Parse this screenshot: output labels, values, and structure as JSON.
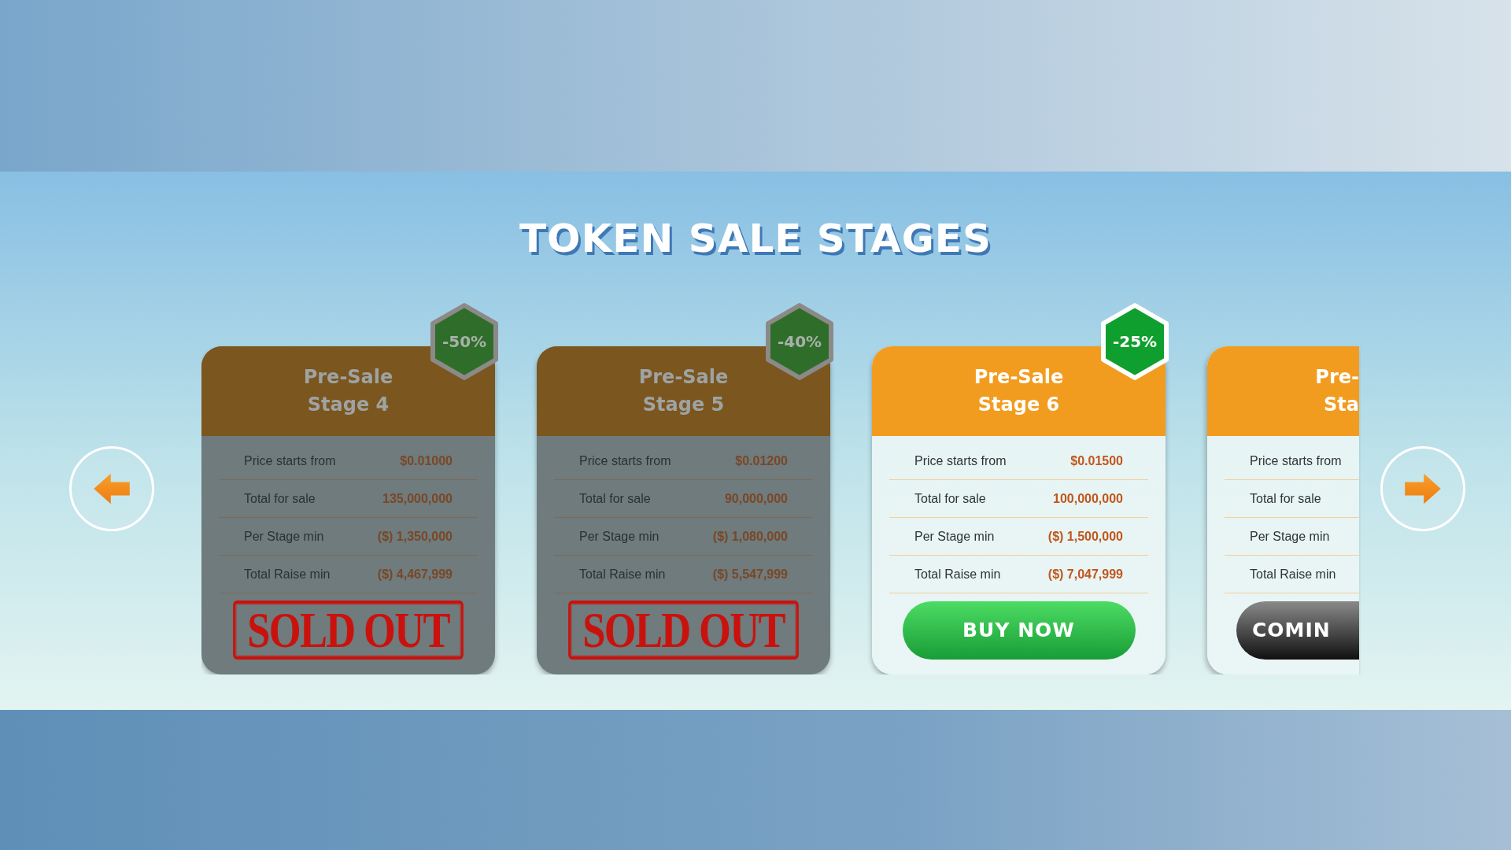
{
  "title": "TOKEN SALE STAGES",
  "stages": [
    {
      "name": "Pre-Sale",
      "stage": "Stage 4",
      "kind": "sold_out",
      "clipped": false,
      "discount": "-50%",
      "rows": [
        {
          "label": "Price starts from",
          "value": "$0.01000"
        },
        {
          "label": "Total for sale",
          "value": "135,000,000"
        },
        {
          "label": "Per Stage min",
          "value": "($) 1,350,000"
        },
        {
          "label": "Total Raise min",
          "value": "($) 4,467,999"
        }
      ],
      "stamp": "SOLD OUT"
    },
    {
      "name": "Pre-Sale",
      "stage": "Stage 5",
      "kind": "sold_out",
      "clipped": false,
      "discount": "-40%",
      "rows": [
        {
          "label": "Price starts from",
          "value": "$0.01200"
        },
        {
          "label": "Total for sale",
          "value": "90,000,000"
        },
        {
          "label": "Per Stage min",
          "value": "($) 1,080,000"
        },
        {
          "label": "Total Raise min",
          "value": "($) 5,547,999"
        }
      ],
      "stamp": "SOLD OUT"
    },
    {
      "name": "Pre-Sale",
      "stage": "Stage 6",
      "kind": "active",
      "clipped": false,
      "discount": "-25%",
      "rows": [
        {
          "label": "Price starts from",
          "value": "$0.01500"
        },
        {
          "label": "Total for sale",
          "value": "100,000,000"
        },
        {
          "label": "Per Stage min",
          "value": "($) 1,500,000"
        },
        {
          "label": "Total Raise min",
          "value": "($) 7,047,999"
        }
      ],
      "button": "BUY NOW"
    },
    {
      "name": "Pre-",
      "stage": "Sta",
      "kind": "upcoming",
      "clipped": true,
      "rows": [
        {
          "label": "Price starts from"
        },
        {
          "label": "Total for sale"
        },
        {
          "label": "Per Stage min"
        },
        {
          "label": "Total Raise min"
        }
      ],
      "button": "COMIN"
    }
  ]
}
